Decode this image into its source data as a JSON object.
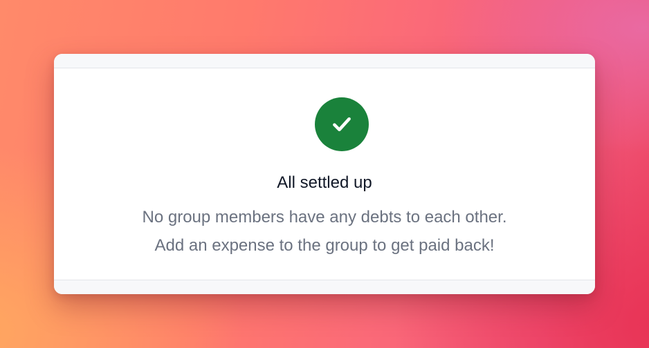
{
  "empty_state": {
    "icon": "check-circle-icon",
    "icon_color": "#1a823b",
    "title": "All settled up",
    "message_line_1": "No group members have any debts to each other.",
    "message_line_2": "Add an expense to the group to get paid back!"
  }
}
